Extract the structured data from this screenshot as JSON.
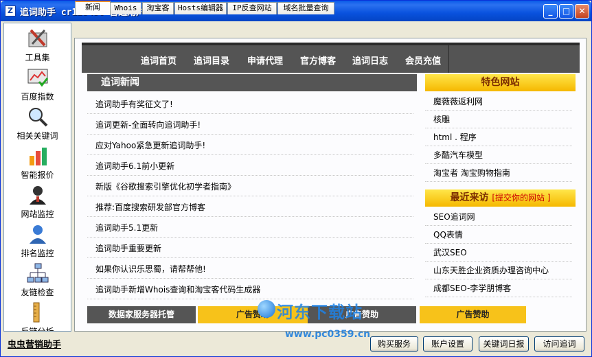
{
  "window": {
    "title": "追词助手  cr123456 普通用户",
    "minimize": "_",
    "maximize": "□",
    "close": "✕"
  },
  "sidebar": {
    "items": [
      {
        "label": "工具集",
        "icon": "toolbox-icon"
      },
      {
        "label": "百度指数",
        "icon": "monitor-chart-icon"
      },
      {
        "label": "相关关键词",
        "icon": "magnifier-icon"
      },
      {
        "label": "智能报价",
        "icon": "bar-chart-icon"
      },
      {
        "label": "网站监控",
        "icon": "user-icon"
      },
      {
        "label": "排名监控",
        "icon": "person-icon"
      },
      {
        "label": "友链检查",
        "icon": "network-icon"
      },
      {
        "label": "反链分析",
        "icon": "ruler-icon"
      }
    ]
  },
  "tabs": [
    {
      "label": "新闻"
    },
    {
      "label": "Whois"
    },
    {
      "label": "淘宝客"
    },
    {
      "label": "Hosts编辑器"
    },
    {
      "label": "IP反查网站"
    },
    {
      "label": "域名批量查询"
    }
  ],
  "nav": {
    "items": [
      "追词首页",
      "追词目录",
      "申请代理",
      "官方博客",
      "追词日志",
      "会员充值"
    ]
  },
  "news": {
    "title": "追词新闻",
    "items": [
      "追词助手有奖征文了!",
      "追词更新-全面转向追词助手!",
      "应对Yahoo紧急更新追词助手!",
      "追词助手6.1前小更新",
      "新版《谷歌搜索引擎优化初学者指南》",
      "推荐:百度搜索研发部官方博客",
      "追词助手5.1更新",
      "追词助手重要更新",
      "如果你认识乐思蜀，请帮帮他!",
      "追词助手新增Whois查询和淘宝客代码生成器"
    ]
  },
  "featured": {
    "title": "特色网站",
    "items": [
      "魔薇薇返利网",
      "核雕",
      "html . 程序",
      "多酷汽车模型",
      "淘宝者  淘宝购物指南"
    ]
  },
  "recent": {
    "title": "最近来访",
    "submit": "[提交你的网站 ]",
    "items": [
      "SEO追词网",
      "QQ表情",
      "武汉SEO",
      "山东天胜企业资质办理咨询中心",
      "成都SEO-李学朋博客"
    ]
  },
  "bottom": {
    "hosting": "数据家服务器托管",
    "ad1": "广告赞助",
    "ad2": "广告赞助",
    "ad3": "广告赞助"
  },
  "watermark": {
    "text": "河东下载站",
    "url": "www.pc0359.cn"
  },
  "footer": {
    "brand": "虫虫营销助手",
    "buttons": [
      "购买服务",
      "账户设置",
      "关键词日报",
      "访问追词"
    ]
  }
}
